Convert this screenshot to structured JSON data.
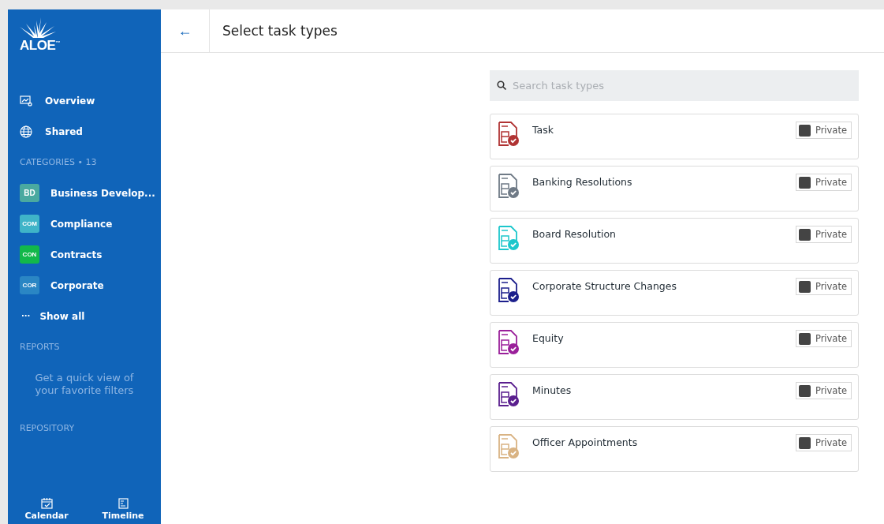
{
  "sidebar": {
    "logo": "ALOE",
    "logo_mark": "™",
    "nav": [
      {
        "label": "Overview",
        "selected": false
      },
      {
        "label": "Shared",
        "selected": false
      }
    ],
    "categories_heading": "CATEGORIES • 13",
    "categories": [
      {
        "badge": "BD",
        "label": "Business Develop...",
        "color": "#4aa9a0"
      },
      {
        "badge": "COM",
        "label": "Compliance",
        "color": "#3fb4c8"
      },
      {
        "badge": "CON",
        "label": "Contracts",
        "color": "#12b84a"
      },
      {
        "badge": "COR",
        "label": "Corporate",
        "color": "#2a86c4"
      }
    ],
    "show_all": {
      "icon": "···",
      "label": "Show all"
    },
    "reports_heading": "REPORTS",
    "reports_empty": "Get a quick view of your favorite filters",
    "repository_heading": "REPOSITORY",
    "bottom": [
      {
        "label": "Calendar"
      },
      {
        "label": "Timeline"
      }
    ]
  },
  "header": {
    "back": "←",
    "title": "Select task types"
  },
  "search": {
    "placeholder": "Search task types"
  },
  "task_types": [
    {
      "name": "Task",
      "color": "#b03333",
      "private": {
        "label": "Private",
        "checked": false
      }
    },
    {
      "name": "Banking Resolutions",
      "color": "#6f7a86",
      "private": {
        "label": "Private",
        "checked": false
      }
    },
    {
      "name": "Board Resolution",
      "color": "#1cc7cc",
      "private": {
        "label": "Private",
        "checked": false
      }
    },
    {
      "name": "Corporate Structure Changes",
      "color": "#1c1f8c",
      "private": {
        "label": "Private",
        "checked": false
      }
    },
    {
      "name": "Equity",
      "color": "#9a1f9a",
      "private": {
        "label": "Private",
        "checked": false
      }
    },
    {
      "name": "Minutes",
      "color": "#5a1f8e",
      "private": {
        "label": "Private",
        "checked": false
      }
    },
    {
      "name": "Officer Appointments",
      "color": "#d9b383",
      "private": {
        "label": "Private",
        "checked": false
      }
    }
  ]
}
